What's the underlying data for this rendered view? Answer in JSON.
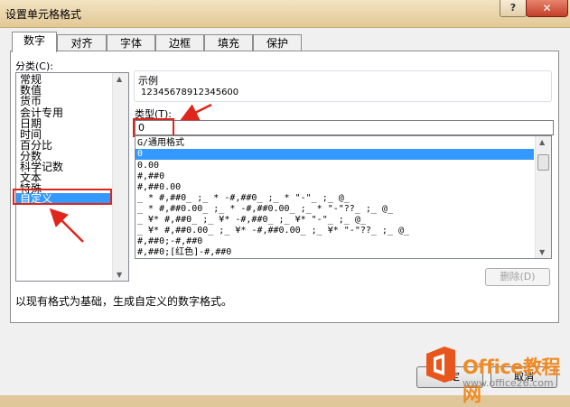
{
  "window": {
    "title": "设置单元格格式",
    "help_glyph": "?",
    "close_glyph": "✕"
  },
  "tabs": [
    "数字",
    "对齐",
    "字体",
    "边框",
    "填充",
    "保护"
  ],
  "category": {
    "label": "分类(C):",
    "items": [
      "常规",
      "数值",
      "货币",
      "会计专用",
      "日期",
      "时间",
      "百分比",
      "分数",
      "科学记数",
      "文本",
      "特殊",
      "自定义"
    ],
    "selected": "自定义"
  },
  "example": {
    "label": "示例",
    "value": "12345678912345600"
  },
  "type": {
    "label": "类型(T):",
    "value": "0"
  },
  "formats": {
    "items": [
      "G/通用格式",
      "0",
      "0.00",
      "#,##0",
      "#,##0.00",
      "_ * #,##0_ ;_ * -#,##0_ ;_ * \"-\"_ ;_ @_",
      "_ * #,##0.00_ ;_ * -#,##0.00_ ;_ * \"-\"??_ ;_ @_",
      "_ ¥* #,##0_ ;_ ¥* -#,##0_ ;_ ¥* \"-\"_ ;_ @_",
      "_ ¥* #,##0.00_ ;_ ¥* -#,##0.00_ ;_ ¥* \"-\"??_ ;_ @_",
      "#,##0;-#,##0",
      "#,##0;[红色]-#,##0"
    ],
    "selected": "0"
  },
  "delete_button": "删除(D)",
  "description": "以现有格式为基础，生成自定义的数字格式。",
  "dialog_buttons": {
    "ok": "确定",
    "cancel": "取消"
  },
  "watermark": {
    "brand": "Office教程网",
    "url": "www.office26.com"
  },
  "colors": {
    "selection": "#3399ff",
    "annotation": "#e0261c",
    "brand": "#f08a24"
  }
}
